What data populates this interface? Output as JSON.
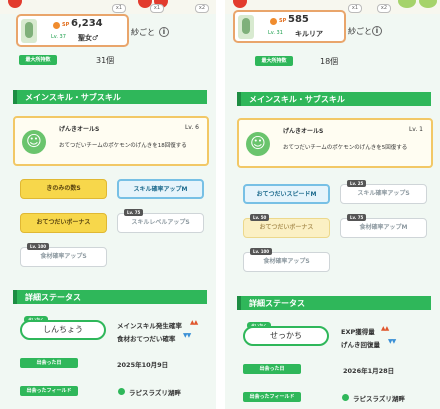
{
  "left": {
    "strip_tokens": [
      "x1",
      "x1",
      "x2"
    ],
    "sp_label": "SP",
    "sp_value": "6,234",
    "level": "Lv. 37",
    "pokemon_name": "聖女♂",
    "nickname": "紗ごと",
    "info_icon": "i",
    "max_carry_label": "最大所持数",
    "max_carry_value": "31個",
    "skills_header": "メインスキル・サブスキル",
    "main_skill_name": "げんきオールS",
    "main_skill_level": "Lv. 6",
    "main_skill_desc": "おてつだいチームのポケモンのげんきを18回復する",
    "sub_skills": [
      {
        "label": "きのみの数S",
        "tag": ""
      },
      {
        "label": "スキル確率アップM",
        "tag": ""
      },
      {
        "label": "おてつだいボーナス",
        "tag": ""
      },
      {
        "label": "スキルレベルアップS",
        "tag": "Lv. 75"
      },
      {
        "label": "食材確率アップS",
        "tag": "Lv. 100"
      }
    ],
    "status_header": "詳細ステータス",
    "nature_label": "せいかく",
    "nature": "しんちょう",
    "stat_up": "メインスキル発生確率",
    "stat_down": "食材おてつだい確率",
    "arrows_up": "▲▲",
    "arrows_down": "▼▼",
    "met_label": "出会った日",
    "met_date": "2025年10月9日",
    "field_label": "出会ったフィールド",
    "field": "ラピスラズリ湖畔"
  },
  "right": {
    "strip_tokens": [
      "x1",
      "x2"
    ],
    "sp_label": "SP",
    "sp_value": "585",
    "level": "Lv. 31",
    "pokemon_name": "キルリア",
    "nickname": "紗ごと",
    "info_icon": "i",
    "max_carry_label": "最大所持数",
    "max_carry_value": "18個",
    "skills_header": "メインスキル・サブスキル",
    "main_skill_name": "げんきオールS",
    "main_skill_level": "Lv. 1",
    "main_skill_desc": "おてつだいチームのポケモンのげんきを5回復する",
    "sub_skills": [
      {
        "label": "おてつだいスピードM",
        "tag": ""
      },
      {
        "label": "スキル確率アップS",
        "tag": "Lv. 25"
      },
      {
        "label": "おてつだいボーナス",
        "tag": "Lv. 50"
      },
      {
        "label": "食材確率アップM",
        "tag": "Lv. 75"
      },
      {
        "label": "食材確率アップS",
        "tag": "Lv. 100"
      }
    ],
    "status_header": "詳細ステータス",
    "nature_label": "せいかく",
    "nature": "せっかち",
    "stat_up": "EXP獲得量",
    "stat_down": "げんき回復量",
    "arrows_up": "▲▲",
    "arrows_down": "▼▼",
    "met_label": "出会った日",
    "met_date": "2026年1月28日",
    "field_label": "出会ったフィールド",
    "field": "ラピスラズリ湖畔"
  }
}
